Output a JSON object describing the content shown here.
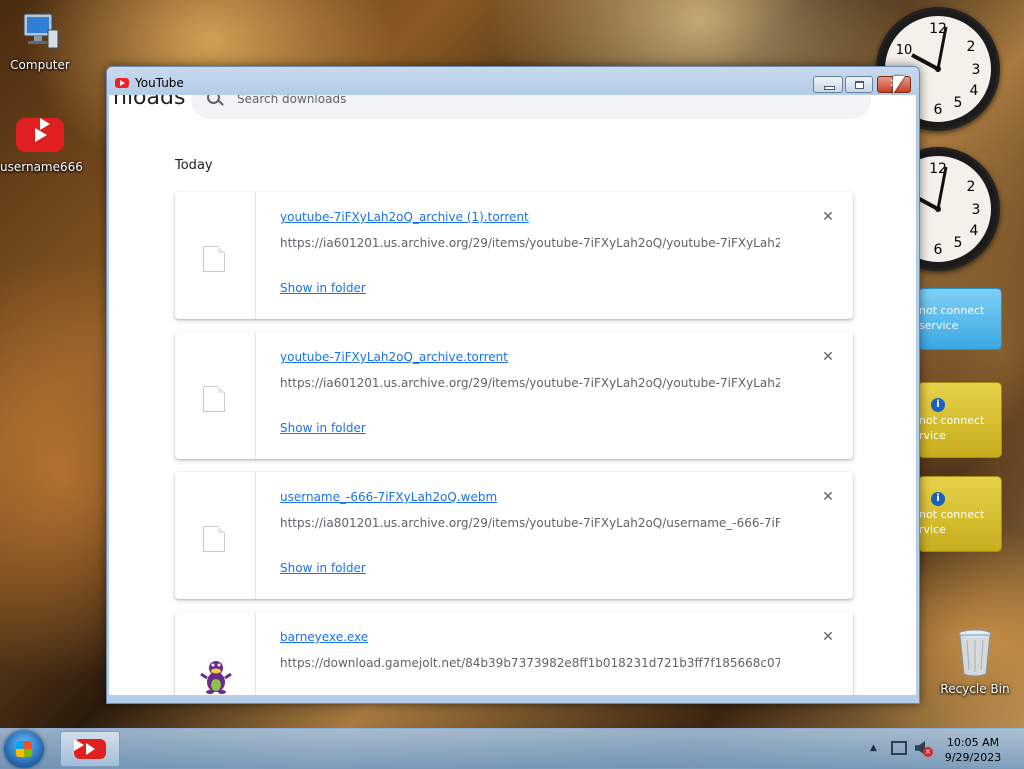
{
  "desktop": {
    "icons": [
      {
        "label": "Computer",
        "icon": "computer-icon"
      },
      {
        "label": "username666",
        "icon": "youtube-icon"
      },
      {
        "label": "Recycle Bin",
        "icon": "recycle-bin-icon"
      }
    ]
  },
  "gadgets": {
    "clocks": [
      {
        "hour": 10,
        "minute": 5
      },
      {
        "hour": 10,
        "minute": 5
      }
    ],
    "feeds": [
      {
        "text_line1": "not connect",
        "text_line2": "service",
        "style": "blue"
      },
      {
        "text_line1": "not connect",
        "text_line2": "rvice",
        "style": "gold"
      },
      {
        "text_line1": "not connect",
        "text_line2": "rvice",
        "style": "gold"
      }
    ]
  },
  "window": {
    "title": "YouTube",
    "page_heading": "nloads",
    "search_placeholder": "Search downloads",
    "section_title": "Today",
    "downloads": [
      {
        "name": "youtube-7iFXyLah2oQ_archive (1).torrent",
        "url": "https://ia601201.us.archive.org/29/items/youtube-7iFXyLah2oQ/youtube-7iFXyLah2...",
        "action": "Show in folder",
        "icon": "file-icon"
      },
      {
        "name": "youtube-7iFXyLah2oQ_archive.torrent",
        "url": "https://ia601201.us.archive.org/29/items/youtube-7iFXyLah2oQ/youtube-7iFXyLah2...",
        "action": "Show in folder",
        "icon": "file-icon"
      },
      {
        "name": "username_-666-7iFXyLah2oQ.webm",
        "url": "https://ia801201.us.archive.org/29/items/youtube-7iFXyLah2oQ/username_-666-7iF...",
        "action": "Show in folder",
        "icon": "file-icon"
      },
      {
        "name": "barneyexe.exe",
        "url": "https://download.gamejolt.net/84b39b7373982e8ff1b018231d721b3ff7f185668c07...",
        "action": "",
        "icon": "barney-icon"
      }
    ]
  },
  "taskbar": {
    "time": "10:05 AM",
    "date": "9/29/2023",
    "colors": {
      "accent": "#1a73e8",
      "youtube_red": "#e02020"
    }
  }
}
